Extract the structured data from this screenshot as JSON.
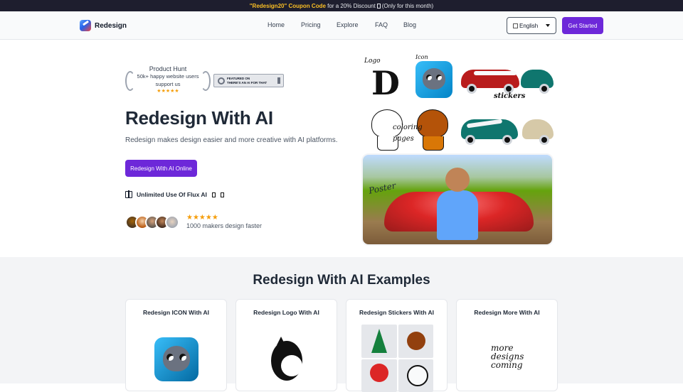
{
  "banner": {
    "code": "\"Redesign20\" Coupon Code",
    "text_before_box": "for a 20% Discount",
    "text_after_box": "(Only for this month)"
  },
  "nav": {
    "brand": "Redesign",
    "links": [
      "Home",
      "Pricing",
      "Explore",
      "FAQ",
      "Blog"
    ],
    "language": "English",
    "cta": "Get Started"
  },
  "hero": {
    "award_title": "Product Hunt",
    "award_line1": "50k+ happy website users",
    "award_line2": "support us",
    "award_stars": "★★★★★",
    "aft_line1": "FEATURED ON",
    "aft_line2": "THERE'S AN AI FOR THAT",
    "title": "Redesign With AI",
    "subtitle": "Redesign makes design easier and more creative with AI platforms.",
    "cta": "Redesign With AI Online",
    "feature": "Unlimited Use Of Flux AI",
    "rating_stars": "★★★★★",
    "rating_text": "1000 makers design faster",
    "collage_labels": {
      "logo": "Logo",
      "icon": "Icon",
      "stickers": "stickers",
      "coloring": "coloring",
      "pages": "pages",
      "poster": "Poster"
    }
  },
  "examples": {
    "title": "Redesign With AI Examples",
    "cards": [
      {
        "title": "Redesign ICON With AI"
      },
      {
        "title": "Redesign Logo With AI"
      },
      {
        "title": "Redesign Stickers With AI"
      },
      {
        "title": "Redesign More With AI",
        "image_text_1": "more",
        "image_text_2": "designs",
        "image_text_3": "coming"
      }
    ]
  },
  "colors": {
    "accent": "#6d28d9",
    "coupon": "#fbbf24",
    "star": "#f59e0b"
  }
}
